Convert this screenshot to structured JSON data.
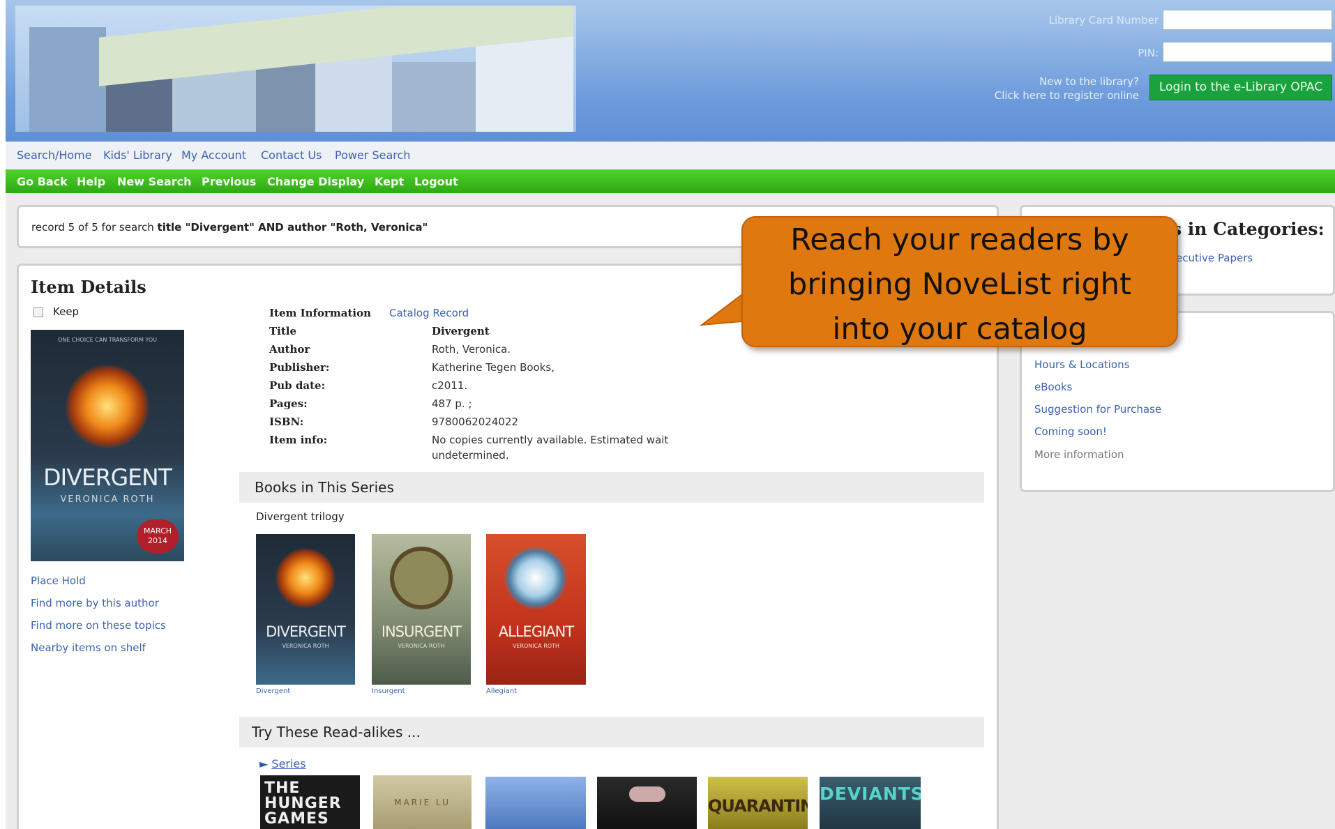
{
  "header": {
    "card_label": "Library Card Number",
    "pin_label": "PIN:",
    "register_line1": "New to the library?",
    "register_line2": "Click here to register online",
    "login_button": "Login to the e-Library OPAC"
  },
  "top_nav": [
    "Search/Home",
    "Kids' Library",
    "My Account",
    "Contact Us",
    "Power Search"
  ],
  "green_nav": [
    "Go Back",
    "Help",
    "New Search",
    "Previous",
    "Change Display",
    "Kept",
    "Logout"
  ],
  "search_info": {
    "prefix": "record 5 of 5 for search",
    "query": "title \"Divergent\" AND author \"Roth, Veronica\""
  },
  "item": {
    "heading": "Item Details",
    "keep_label": "Keep",
    "info_label": "Item Information",
    "catalog_link": "Catalog Record",
    "fields": [
      {
        "label": "Title",
        "value": "Divergent"
      },
      {
        "label": "Author",
        "value": "Roth, Veronica."
      },
      {
        "label": "Publisher:",
        "value": "Katherine Tegen Books,"
      },
      {
        "label": "Pub date:",
        "value": "c2011."
      },
      {
        "label": "Pages:",
        "value": "487 p. ;"
      },
      {
        "label": "ISBN:",
        "value": "9780062024022"
      },
      {
        "label": "Item info:",
        "value": "No copies currently available. Estimated wait"
      }
    ],
    "item_info_line2": "undetermined.",
    "actions": [
      "Place Hold",
      "Find more by this author",
      "Find more on these topics",
      "Nearby items on shelf"
    ],
    "cover": {
      "top_text": "ONE CHOICE CAN TRANSFORM YOU",
      "title": "DIVERGENT",
      "author": "VERONICA ROTH",
      "badge": "MARCH 2014"
    }
  },
  "series": {
    "heading": "Books in This Series",
    "name": "Divergent trilogy",
    "books": [
      {
        "title": "DIVERGENT",
        "author": "VERONICA ROTH",
        "caption": "Divergent"
      },
      {
        "title": "INSURGENT",
        "author": "VERONICA ROTH",
        "caption": "Insurgent"
      },
      {
        "title": "ALLEGIANT",
        "author": "VERONICA ROTH",
        "caption": "Allegiant"
      }
    ]
  },
  "readalikes": {
    "heading": "Try These Read-alikes ...",
    "series_link": "Series",
    "covers": [
      {
        "text": "THE HUNGER GAMES",
        "color": "#1a1a1a"
      },
      {
        "text": "MARIE LU",
        "color": "#b9b08a"
      },
      {
        "text": "",
        "color": "#5d86c8"
      },
      {
        "text": "",
        "color": "#1f1f1f"
      },
      {
        "text": "QUARANTINE",
        "color": "#a89a22"
      },
      {
        "text": "DEVIANTS",
        "color": "#2e4a58"
      }
    ]
  },
  "sidebar": {
    "cat_heading_fragment": "s in Categories:",
    "cat_link_fragment": "ecutive Papers",
    "links": [
      "Hours & Locations",
      "eBooks",
      "Suggestion for Purchase",
      "Coming soon!"
    ],
    "more": "More information"
  },
  "callout": {
    "lines": [
      "Reach your readers by",
      "bringing NoveList right",
      "into your catalog"
    ]
  }
}
